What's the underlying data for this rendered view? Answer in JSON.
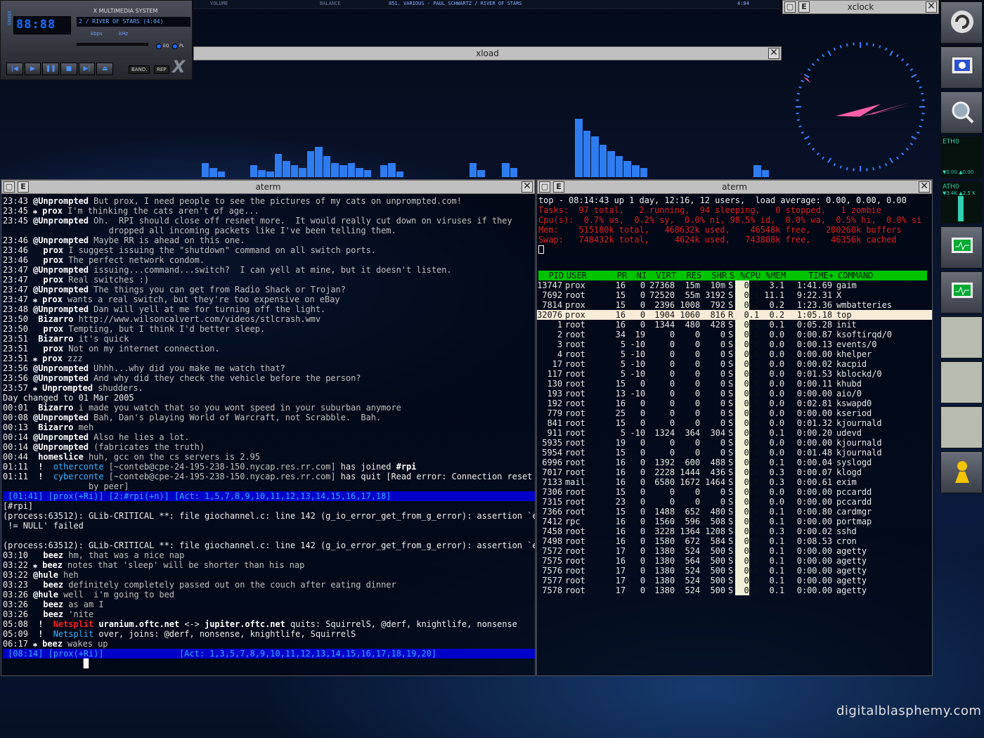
{
  "xmms": {
    "title": "X MULTIMEDIA SYSTEM",
    "time": "88:88",
    "song": "2 / RIVER OF STARS (4:04)",
    "kbps": "kbps",
    "khz": "kHz",
    "eq_label": "EQ",
    "pl_label": "PL",
    "band_label": "BAND.",
    "rep_label": "REP",
    "side_label": "XMMS",
    "controls": [
      "|◀",
      "▶",
      "❚❚",
      "■",
      "▶|",
      "⏏"
    ]
  },
  "eqbar": {
    "volume": "VOLUME",
    "balance": "BALANCE",
    "track": "851. VARIOUS - PAUL SCHWARTZ / RIVER OF STARS",
    "time": "4:04"
  },
  "xload": {
    "title": "xload",
    "close": "✕",
    "load_levels": [
      0.0,
      0.12,
      0.08,
      0.05,
      0.0,
      0.0,
      0.0,
      0.1,
      0.06,
      0.05,
      0.2,
      0.14,
      0.1,
      0.08,
      0.22,
      0.26,
      0.18,
      0.12,
      0.1,
      0.12,
      0.08,
      0.06,
      0.0,
      0.1,
      0.12,
      0.05,
      0.0,
      0.0,
      0.0,
      0.0,
      0.0,
      0.0,
      0.0,
      0.0,
      0.12,
      0.06,
      0.0,
      0.0,
      0.12,
      0.08,
      0.0,
      0.0,
      0.0,
      0.0,
      0.0,
      0.0,
      0.0,
      0.5,
      0.4,
      0.35,
      0.28,
      0.22,
      0.18,
      0.14,
      0.1,
      0.08,
      0.0,
      0.0,
      0.0,
      0.0,
      0.0,
      0.0,
      0.0,
      0.0,
      0.0,
      0.0,
      0.0,
      0.0,
      0.0,
      0.1,
      0.06,
      0.0
    ]
  },
  "xclock": {
    "title": "xclock",
    "minimize": "▢",
    "menu": "E",
    "close": "✕"
  },
  "dock": {
    "eth0_1": "ETH0",
    "eth0_2": "ATH0",
    "rate1": "▼0.00 ▲0.00",
    "rate2": "▼3.4K ▲2.5 K"
  },
  "irc": {
    "title": "aterm",
    "lines": [
      {
        "t": "23:43",
        "n": " @Unprompted",
        "m": " But prox, I need people to see the pictures of my cats on unprompted.com!"
      },
      {
        "t": "23:45",
        "n": " ⁎ prox",
        "m": " I'm thinking the cats aren't of age..."
      },
      {
        "t": "23:45",
        "n": " @Unprompted",
        "m": " Oh.  RPI should close off resnet more.  It would really cut down on viruses if they"
      },
      {
        "t": "",
        "n": "",
        "m": "                     dropped all incoming packets like I've been telling them."
      },
      {
        "t": "23:46",
        "n": " @Unprompted",
        "m": " Maybe RR is ahead on this one."
      },
      {
        "t": "23:46",
        "n": "   prox",
        "m": " I suggest issuing the \"shutdown\" command on all switch ports."
      },
      {
        "t": "23:46",
        "n": "   prox",
        "m": " The perfect network condom."
      },
      {
        "t": "23:47",
        "n": " @Unprompted",
        "m": " issuing...command...switch?  I can yell at mine, but it doesn't listen."
      },
      {
        "t": "23:47",
        "n": "   prox",
        "m": " Real switches :)"
      },
      {
        "t": "23:47",
        "n": " @Unprompted",
        "m": " The things you can get from Radio Shack or Trojan?"
      },
      {
        "t": "23:47",
        "n": " ⁎ prox",
        "m": " wants a real switch, but they're too expensive on eBay"
      },
      {
        "t": "23:48",
        "n": " @Unprompted",
        "m": " Dan will yell at me for turning off the light."
      },
      {
        "t": "23:50",
        "n": "  Bizarro",
        "m": " http://www.wilsoncalvert.com/videos/stlcrash.wmv"
      },
      {
        "t": "23:50",
        "n": "   prox",
        "m": " Tempting, but I think I'd better sleep."
      },
      {
        "t": "23:51",
        "n": "  Bizarro",
        "m": " it's quick"
      },
      {
        "t": "23:51",
        "n": "   prox",
        "m": " Not on my internet connection."
      },
      {
        "t": "23:51",
        "n": " ⁎ prox",
        "m": " zzz"
      },
      {
        "t": "23:56",
        "n": " @Unprompted",
        "m": " Uhhh...why did you make me watch that?"
      },
      {
        "t": "23:56",
        "n": " @Unprompted",
        "m": " And why did they check the vehicle before the person?"
      },
      {
        "t": "23:57",
        "n": " ⁎ Unprompted",
        "m": " shudders."
      },
      {
        "t": "Day changed to 01 Mar 2005",
        "n": "",
        "m": ""
      },
      {
        "t": "00:01",
        "n": "  Bizarro",
        "m": " i made you watch that so you wont speed in your suburban anymore"
      },
      {
        "t": "00:08",
        "n": " @Unprompted",
        "m": " Bah, Dan's playing World of Warcraft, not Scrabble.  Bah."
      },
      {
        "t": "00:13",
        "n": "  Bizarro",
        "m": " meh"
      },
      {
        "t": "00:14",
        "n": " @Unprompted",
        "m": " Also he lies a lot."
      },
      {
        "t": "00:14",
        "n": " @Unprompted",
        "m": " (fabricates the truth)"
      },
      {
        "t": "00:44",
        "n": "  homeslice",
        "m": " huh, gcc on the cs servers is 2.95"
      }
    ],
    "join": {
      "t": "01:11",
      "bang": "!",
      "nick": "otherconte",
      "host": "[~conteb@cpe-24-195-238-150.nycap.res.rr.com]",
      "rest": " has joined ",
      "chan": "#rpi"
    },
    "quit": {
      "t": "01:11",
      "bang": "!",
      "nick": "cyberconte",
      "host": "[~conteb@cpe-24-195-238-150.nycap.res.rr.com]",
      "rest": " has quit [Read error: Connection reset",
      "cont": "                 by peer]"
    },
    "status1": " [01:41] [prox(+Ri)] [2:#rpi(+n)] [Act: 1,5,7,8,9,10,11,12,13,14,15,16,17,18]",
    "win_label": "[#rpi]",
    "lines2": [
      "(process:63512): GLib-CRITICAL **: file giochannel.c: line 142 (g_io_error_get_from_g_error): assertion `err",
      " != NULL' failed",
      "",
      "(process:63512): GLib-CRITICAL **: file giochannel.c: line 142 (g_io_error_get_from_g_error): assertion `err"
    ],
    "lines3": [
      {
        "t": "03:10",
        "n": "   beez",
        "m": " hm, that was a nice nap"
      },
      {
        "t": "03:22",
        "n": " ⁎ beez",
        "m": " notes that 'sleep' will be shorter than his nap"
      },
      {
        "t": "03:22",
        "n": " @hule",
        "m": " heh"
      },
      {
        "t": "03:23",
        "n": "   beez",
        "m": " definitely completely passed out on the couch after eating dinner"
      },
      {
        "t": "03:26",
        "n": " @hule",
        "m": " well  i'm going to bed"
      },
      {
        "t": "03:26",
        "n": "   beez",
        "m": " as am I"
      },
      {
        "t": "03:26",
        "n": "   beez",
        "m": " 'nite"
      }
    ],
    "split1": {
      "t": "05:08",
      "bang": "!",
      "label": "Netsplit",
      "a": "uranium.oftc.net",
      "arrow": " <-> ",
      "b": "jupiter.oftc.net",
      "rest": " quits: SquirrelS, @derf, knightlife, nonsense"
    },
    "split2": {
      "t": "05:09",
      "bang": "!",
      "label": "Netsplit",
      "rest": " over, joins: @derf, nonsense, knightlife, SquirrelS"
    },
    "last": {
      "t": "06:17",
      "n": " ⁎ beez",
      "m": " wakes up"
    },
    "status2a": " [08:14] [prox(+Ri)]",
    "status2b": "[Act: 1,3,5,7,8,9,10,11,12,13,14,15,16,17,18,19,20]"
  },
  "top": {
    "title": "aterm",
    "l1": "top - 08:14:43 up 1 day, 12:16, 12 users,  load average: 0.00, 0.00, 0.00",
    "l2": "Tasks:  97 total,   2 running,  94 sleeping,   0 stopped,   1 zombie",
    "l3": "Cpu(s):  0.7% us,  0.2% sy,  0.0% ni, 98.5% id,  0.0% wa,  0.5% hi,  0.0% si",
    "l4": "Mem:    515180k total,   468632k used,    46548k free,   200260k buffers",
    "l5": "Swap:   748432k total,     4624k used,   743808k free,    46356k cached",
    "headers": [
      "PID",
      "USER",
      "PR",
      "NI",
      "VIRT",
      "RES",
      "SHR",
      "S",
      "%CPU",
      "%MEM",
      "TIME+",
      "COMMAND"
    ],
    "rows": [
      [
        "13747",
        "prox",
        "16",
        "0",
        "27368",
        "15m",
        "10m",
        "S",
        "0.5",
        "3.1",
        "1:41.69",
        "gaim"
      ],
      [
        "7692",
        "root",
        "15",
        "0",
        "72520",
        "55m",
        "3192",
        "S",
        "0.1",
        "11.1",
        "9:22.31",
        "X"
      ],
      [
        "7814",
        "prox",
        "15",
        "0",
        "2396",
        "1008",
        "792",
        "S",
        "0.1",
        "0.2",
        "1:23.36",
        "wmbatteries"
      ],
      [
        "32076",
        "prox",
        "16",
        "0",
        "1904",
        "1060",
        "816",
        "R",
        "0.1",
        "0.2",
        "1:05.18",
        "top"
      ],
      [
        "1",
        "root",
        "16",
        "0",
        "1344",
        "480",
        "428",
        "S",
        "0.0",
        "0.1",
        "0:05.28",
        "init"
      ],
      [
        "2",
        "root",
        "34",
        "19",
        "0",
        "0",
        "0",
        "S",
        "0.0",
        "0.0",
        "0:00.87",
        "ksoftirqd/0"
      ],
      [
        "3",
        "root",
        "5",
        "-10",
        "0",
        "0",
        "0",
        "S",
        "0.0",
        "0.0",
        "0:00.13",
        "events/0"
      ],
      [
        "4",
        "root",
        "5",
        "-10",
        "0",
        "0",
        "0",
        "S",
        "0.0",
        "0.0",
        "0:00.00",
        "khelper"
      ],
      [
        "17",
        "root",
        "5",
        "-10",
        "0",
        "0",
        "0",
        "S",
        "0.0",
        "0.0",
        "0:00.02",
        "kacpid"
      ],
      [
        "117",
        "root",
        "5",
        "-10",
        "0",
        "0",
        "0",
        "S",
        "0.0",
        "0.0",
        "0:01.53",
        "kblockd/0"
      ],
      [
        "130",
        "root",
        "15",
        "0",
        "0",
        "0",
        "0",
        "S",
        "0.0",
        "0.0",
        "0:00.11",
        "khubd"
      ],
      [
        "193",
        "root",
        "13",
        "-10",
        "0",
        "0",
        "0",
        "S",
        "0.0",
        "0.0",
        "0:00.00",
        "aio/0"
      ],
      [
        "192",
        "root",
        "16",
        "0",
        "0",
        "0",
        "0",
        "S",
        "0.0",
        "0.0",
        "0:02.81",
        "kswapd0"
      ],
      [
        "779",
        "root",
        "25",
        "0",
        "0",
        "0",
        "0",
        "S",
        "0.0",
        "0.0",
        "0:00.00",
        "kseriod"
      ],
      [
        "841",
        "root",
        "15",
        "0",
        "0",
        "0",
        "0",
        "S",
        "0.0",
        "0.0",
        "0:01.32",
        "kjournald"
      ],
      [
        "911",
        "root",
        "5",
        "-10",
        "1324",
        "364",
        "304",
        "S",
        "0.0",
        "0.1",
        "0:00.20",
        "udevd"
      ],
      [
        "5935",
        "root",
        "19",
        "0",
        "0",
        "0",
        "0",
        "S",
        "0.0",
        "0.0",
        "0:00.00",
        "kjournald"
      ],
      [
        "5954",
        "root",
        "15",
        "0",
        "0",
        "0",
        "0",
        "S",
        "0.0",
        "0.0",
        "0:01.48",
        "kjournald"
      ],
      [
        "6996",
        "root",
        "16",
        "0",
        "1392",
        "600",
        "488",
        "S",
        "0.0",
        "0.1",
        "0:00.04",
        "syslogd"
      ],
      [
        "7017",
        "root",
        "16",
        "0",
        "2228",
        "1444",
        "436",
        "S",
        "0.0",
        "0.3",
        "0:00.07",
        "klogd"
      ],
      [
        "7133",
        "mail",
        "16",
        "0",
        "6580",
        "1672",
        "1464",
        "S",
        "0.0",
        "0.3",
        "0:00.61",
        "exim"
      ],
      [
        "7306",
        "root",
        "15",
        "0",
        "0",
        "0",
        "0",
        "S",
        "0.0",
        "0.0",
        "0:00.00",
        "pccardd"
      ],
      [
        "7315",
        "root",
        "23",
        "0",
        "0",
        "0",
        "0",
        "S",
        "0.0",
        "0.0",
        "0:00.00",
        "pccardd"
      ],
      [
        "7366",
        "root",
        "15",
        "0",
        "1488",
        "652",
        "480",
        "S",
        "0.0",
        "0.1",
        "0:00.80",
        "cardmgr"
      ],
      [
        "7412",
        "rpc",
        "16",
        "0",
        "1560",
        "596",
        "508",
        "S",
        "0.0",
        "0.1",
        "0:00.00",
        "portmap"
      ],
      [
        "7458",
        "root",
        "16",
        "0",
        "3228",
        "1364",
        "1208",
        "S",
        "0.0",
        "0.3",
        "0:00.02",
        "sshd"
      ],
      [
        "7498",
        "root",
        "16",
        "0",
        "1580",
        "672",
        "584",
        "S",
        "0.0",
        "0.1",
        "0:08.53",
        "cron"
      ],
      [
        "7572",
        "root",
        "17",
        "0",
        "1380",
        "524",
        "500",
        "S",
        "0.0",
        "0.1",
        "0:00.00",
        "agetty"
      ],
      [
        "7575",
        "root",
        "16",
        "0",
        "1380",
        "564",
        "500",
        "S",
        "0.0",
        "0.1",
        "0:00.00",
        "agetty"
      ],
      [
        "7576",
        "root",
        "17",
        "0",
        "1380",
        "524",
        "500",
        "S",
        "0.0",
        "0.1",
        "0:00.00",
        "agetty"
      ],
      [
        "7577",
        "root",
        "17",
        "0",
        "1380",
        "524",
        "500",
        "S",
        "0.0",
        "0.1",
        "0:00.00",
        "agetty"
      ],
      [
        "7578",
        "root",
        "17",
        "0",
        "1380",
        "524",
        "500",
        "S",
        "0.0",
        "0.1",
        "0:00.00",
        "agetty"
      ]
    ]
  },
  "brand": "digitalblasphemy.com"
}
